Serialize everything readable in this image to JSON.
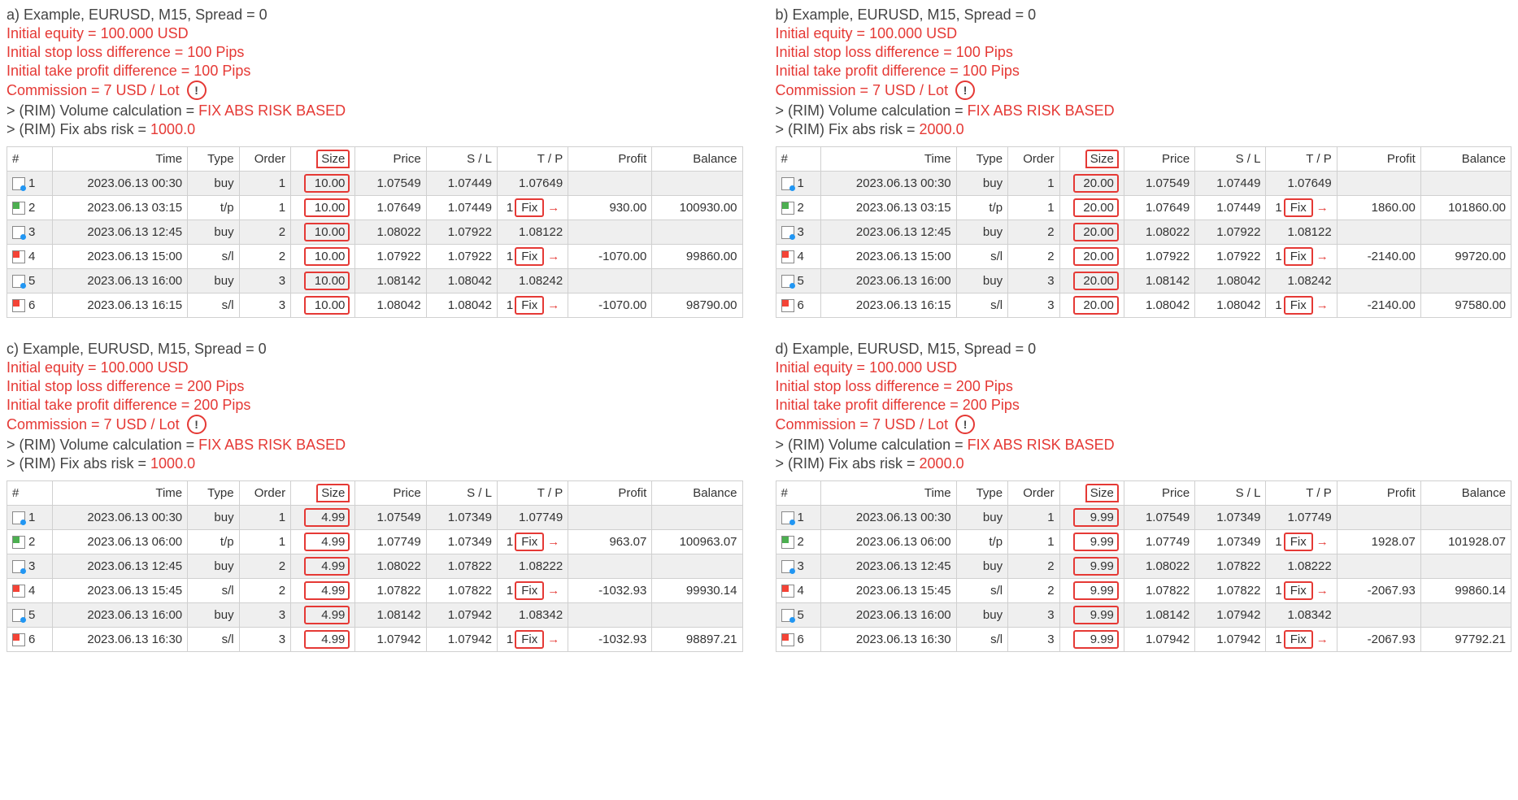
{
  "headers": {
    "num": "#",
    "time": "Time",
    "type": "Type",
    "order": "Order",
    "size": "Size",
    "price": "Price",
    "sl": "S / L",
    "tp": "T / P",
    "profit": "Profit",
    "balance": "Balance"
  },
  "fix_label": "Fix",
  "panels": [
    {
      "id": "a",
      "title": "a) Example, EURUSD, M15, Spread = 0",
      "params": {
        "equity": "Initial equity = 100.000 USD",
        "sl_diff": "Initial stop loss difference = 100 Pips",
        "tp_diff": "Initial take profit difference = 100 Pips",
        "commission": "Commission = 7 USD / Lot ",
        "vol_calc_pre": "> (RIM) Volume calculation = ",
        "vol_calc_val": "FIX ABS RISK BASED",
        "fix_risk_pre": "> (RIM) Fix abs risk = ",
        "fix_risk_val": "1000.0"
      },
      "rows": [
        {
          "icon": "buy",
          "n": "1",
          "time": "2023.06.13 00:30",
          "type": "buy",
          "order": "1",
          "size": "10.00",
          "price": "1.07549",
          "sl": "1.07449",
          "tp": "1.07649",
          "profit": "",
          "balance": ""
        },
        {
          "icon": "tp",
          "n": "2",
          "time": "2023.06.13 03:15",
          "type": "t/p",
          "order": "1",
          "size": "10.00",
          "price": "1.07649",
          "sl": "1.07449",
          "tp_fix": true,
          "profit": "930.00",
          "balance": "100930.00"
        },
        {
          "icon": "buy",
          "n": "3",
          "time": "2023.06.13 12:45",
          "type": "buy",
          "order": "2",
          "size": "10.00",
          "price": "1.08022",
          "sl": "1.07922",
          "tp": "1.08122",
          "profit": "",
          "balance": ""
        },
        {
          "icon": "sl",
          "n": "4",
          "time": "2023.06.13 15:00",
          "type": "s/l",
          "order": "2",
          "size": "10.00",
          "price": "1.07922",
          "sl": "1.07922",
          "tp_fix": true,
          "profit": "-1070.00",
          "balance": "99860.00"
        },
        {
          "icon": "buy",
          "n": "5",
          "time": "2023.06.13 16:00",
          "type": "buy",
          "order": "3",
          "size": "10.00",
          "price": "1.08142",
          "sl": "1.08042",
          "tp": "1.08242",
          "profit": "",
          "balance": ""
        },
        {
          "icon": "sl",
          "n": "6",
          "time": "2023.06.13 16:15",
          "type": "s/l",
          "order": "3",
          "size": "10.00",
          "price": "1.08042",
          "sl": "1.08042",
          "tp_fix": true,
          "profit": "-1070.00",
          "balance": "98790.00"
        }
      ]
    },
    {
      "id": "b",
      "title": "b) Example, EURUSD, M15, Spread = 0",
      "params": {
        "equity": "Initial equity = 100.000 USD",
        "sl_diff": "Initial stop loss difference = 100 Pips",
        "tp_diff": "Initial take profit difference = 100 Pips",
        "commission": "Commission = 7 USD / Lot ",
        "vol_calc_pre": "> (RIM) Volume calculation = ",
        "vol_calc_val": "FIX ABS RISK BASED",
        "fix_risk_pre": "> (RIM) Fix abs risk = ",
        "fix_risk_val": "2000.0"
      },
      "rows": [
        {
          "icon": "buy",
          "n": "1",
          "time": "2023.06.13 00:30",
          "type": "buy",
          "order": "1",
          "size": "20.00",
          "price": "1.07549",
          "sl": "1.07449",
          "tp": "1.07649",
          "profit": "",
          "balance": ""
        },
        {
          "icon": "tp",
          "n": "2",
          "time": "2023.06.13 03:15",
          "type": "t/p",
          "order": "1",
          "size": "20.00",
          "price": "1.07649",
          "sl": "1.07449",
          "tp_fix": true,
          "profit": "1860.00",
          "balance": "101860.00"
        },
        {
          "icon": "buy",
          "n": "3",
          "time": "2023.06.13 12:45",
          "type": "buy",
          "order": "2",
          "size": "20.00",
          "price": "1.08022",
          "sl": "1.07922",
          "tp": "1.08122",
          "profit": "",
          "balance": ""
        },
        {
          "icon": "sl",
          "n": "4",
          "time": "2023.06.13 15:00",
          "type": "s/l",
          "order": "2",
          "size": "20.00",
          "price": "1.07922",
          "sl": "1.07922",
          "tp_fix": true,
          "profit": "-2140.00",
          "balance": "99720.00"
        },
        {
          "icon": "buy",
          "n": "5",
          "time": "2023.06.13 16:00",
          "type": "buy",
          "order": "3",
          "size": "20.00",
          "price": "1.08142",
          "sl": "1.08042",
          "tp": "1.08242",
          "profit": "",
          "balance": ""
        },
        {
          "icon": "sl",
          "n": "6",
          "time": "2023.06.13 16:15",
          "type": "s/l",
          "order": "3",
          "size": "20.00",
          "price": "1.08042",
          "sl": "1.08042",
          "tp_fix": true,
          "profit": "-2140.00",
          "balance": "97580.00"
        }
      ]
    },
    {
      "id": "c",
      "title": "c) Example, EURUSD, M15, Spread = 0",
      "params": {
        "equity": "Initial equity = 100.000 USD",
        "sl_diff": "Initial stop loss difference = 200 Pips",
        "tp_diff": "Initial take profit difference = 200 Pips",
        "commission": "Commission = 7 USD / Lot ",
        "vol_calc_pre": "> (RIM) Volume calculation = ",
        "vol_calc_val": "FIX ABS RISK BASED",
        "fix_risk_pre": "> (RIM) Fix abs risk = ",
        "fix_risk_val": "1000.0"
      },
      "rows": [
        {
          "icon": "buy",
          "n": "1",
          "time": "2023.06.13 00:30",
          "type": "buy",
          "order": "1",
          "size": "4.99",
          "price": "1.07549",
          "sl": "1.07349",
          "tp": "1.07749",
          "profit": "",
          "balance": ""
        },
        {
          "icon": "tp",
          "n": "2",
          "time": "2023.06.13 06:00",
          "type": "t/p",
          "order": "1",
          "size": "4.99",
          "price": "1.07749",
          "sl": "1.07349",
          "tp_fix": true,
          "profit": "963.07",
          "balance": "100963.07"
        },
        {
          "icon": "buy",
          "n": "3",
          "time": "2023.06.13 12:45",
          "type": "buy",
          "order": "2",
          "size": "4.99",
          "price": "1.08022",
          "sl": "1.07822",
          "tp": "1.08222",
          "profit": "",
          "balance": ""
        },
        {
          "icon": "sl",
          "n": "4",
          "time": "2023.06.13 15:45",
          "type": "s/l",
          "order": "2",
          "size": "4.99",
          "price": "1.07822",
          "sl": "1.07822",
          "tp_fix": true,
          "profit": "-1032.93",
          "balance": "99930.14"
        },
        {
          "icon": "buy",
          "n": "5",
          "time": "2023.06.13 16:00",
          "type": "buy",
          "order": "3",
          "size": "4.99",
          "price": "1.08142",
          "sl": "1.07942",
          "tp": "1.08342",
          "profit": "",
          "balance": ""
        },
        {
          "icon": "sl",
          "n": "6",
          "time": "2023.06.13 16:30",
          "type": "s/l",
          "order": "3",
          "size": "4.99",
          "price": "1.07942",
          "sl": "1.07942",
          "tp_fix": true,
          "profit": "-1032.93",
          "balance": "98897.21"
        }
      ]
    },
    {
      "id": "d",
      "title": "d) Example, EURUSD, M15, Spread = 0",
      "params": {
        "equity": "Initial equity = 100.000 USD",
        "sl_diff": "Initial stop loss difference = 200 Pips",
        "tp_diff": "Initial take profit difference = 200 Pips",
        "commission": "Commission = 7 USD / Lot ",
        "vol_calc_pre": "> (RIM) Volume calculation = ",
        "vol_calc_val": "FIX ABS RISK BASED",
        "fix_risk_pre": "> (RIM) Fix abs risk = ",
        "fix_risk_val": "2000.0"
      },
      "rows": [
        {
          "icon": "buy",
          "n": "1",
          "time": "2023.06.13 00:30",
          "type": "buy",
          "order": "1",
          "size": "9.99",
          "price": "1.07549",
          "sl": "1.07349",
          "tp": "1.07749",
          "profit": "",
          "balance": ""
        },
        {
          "icon": "tp",
          "n": "2",
          "time": "2023.06.13 06:00",
          "type": "t/p",
          "order": "1",
          "size": "9.99",
          "price": "1.07749",
          "sl": "1.07349",
          "tp_fix": true,
          "profit": "1928.07",
          "balance": "101928.07"
        },
        {
          "icon": "buy",
          "n": "3",
          "time": "2023.06.13 12:45",
          "type": "buy",
          "order": "2",
          "size": "9.99",
          "price": "1.08022",
          "sl": "1.07822",
          "tp": "1.08222",
          "profit": "",
          "balance": ""
        },
        {
          "icon": "sl",
          "n": "4",
          "time": "2023.06.13 15:45",
          "type": "s/l",
          "order": "2",
          "size": "9.99",
          "price": "1.07822",
          "sl": "1.07822",
          "tp_fix": true,
          "profit": "-2067.93",
          "balance": "99860.14"
        },
        {
          "icon": "buy",
          "n": "5",
          "time": "2023.06.13 16:00",
          "type": "buy",
          "order": "3",
          "size": "9.99",
          "price": "1.08142",
          "sl": "1.07942",
          "tp": "1.08342",
          "profit": "",
          "balance": ""
        },
        {
          "icon": "sl",
          "n": "6",
          "time": "2023.06.13 16:30",
          "type": "s/l",
          "order": "3",
          "size": "9.99",
          "price": "1.07942",
          "sl": "1.07942",
          "tp_fix": true,
          "profit": "-2067.93",
          "balance": "97792.21"
        }
      ]
    }
  ]
}
